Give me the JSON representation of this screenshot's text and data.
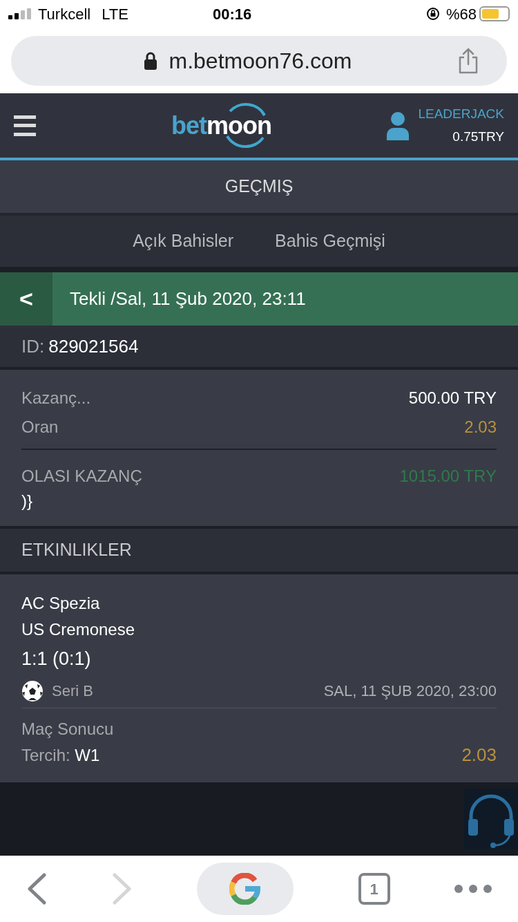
{
  "status_bar": {
    "carrier": "Turkcell",
    "network": "LTE",
    "time": "00:16",
    "battery": "%68"
  },
  "address_bar": {
    "url": "m.betmoon76.com"
  },
  "header": {
    "logo": [
      "bet",
      "moon"
    ],
    "username": "LEADERJACK",
    "balance": "0.75TRY"
  },
  "page_title": "GEÇMIŞ",
  "tabs": [
    {
      "label": "Açık Bahisler"
    },
    {
      "label": "Bahis Geçmişi"
    }
  ],
  "bet_header": {
    "back": "<",
    "title": "Tekli /Sal, 11 Şub 2020, 23:11"
  },
  "bet_id": {
    "label": "ID:",
    "value": "829021564"
  },
  "summary": [
    {
      "label": "Kazanç...",
      "value": "500.00 TRY",
      "kind": "plain"
    },
    {
      "label": "Oran",
      "value": "2.03",
      "kind": "odds"
    }
  ],
  "possible_win": {
    "label": "OLASI KAZANÇ",
    "value": "1015.00 TRY",
    "extra": ")}"
  },
  "events_title": "ETKINLIKLER",
  "events": [
    {
      "home": "AC Spezia",
      "away": "US Cremonese",
      "score": "1:1 (0:1)",
      "league": "Seri B",
      "date": "SAL, 11 ŞUB 2020, 23:00",
      "market": "Maç Sonucu",
      "pick_label": "Tercih:",
      "pick": "W1",
      "odds": "2.03"
    }
  ],
  "bottom_bar": {
    "tab_count": "1"
  }
}
